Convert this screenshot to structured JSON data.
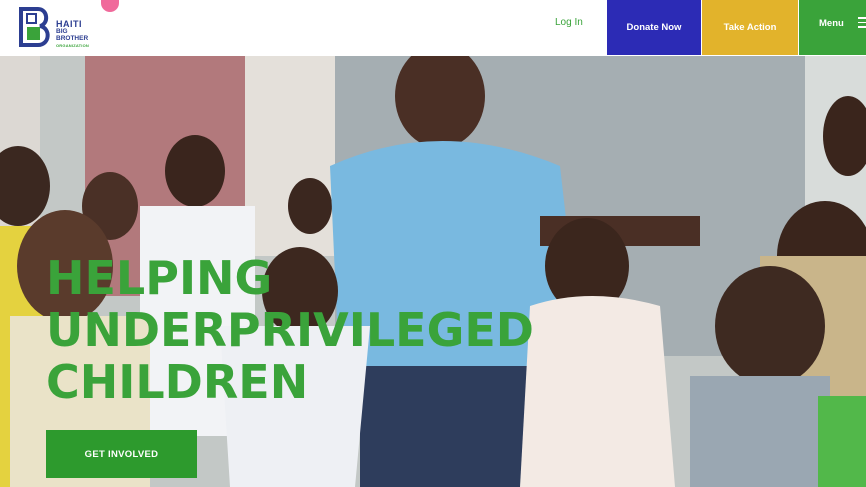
{
  "brand": {
    "line1": "HAITI",
    "line2": "BIG",
    "line3": "BROTHER",
    "line4": "ORGANIZATION",
    "colors": {
      "blue": "#2c3e91",
      "green": "#3aa33a",
      "pink": "#f06a9b"
    }
  },
  "nav": {
    "login": "Log In",
    "donate": "Donate Now",
    "action": "Take Action",
    "menu": "Menu",
    "menu_icon": "hamburger-icon",
    "colors": {
      "donate": "#2c2bb5",
      "action": "#e2b32b",
      "menu": "#3aa33a"
    }
  },
  "hero": {
    "headline": [
      "HELPING",
      "UNDERPRIVILEGED",
      "CHILDREN"
    ],
    "cta": "GET INVOLVED",
    "colors": {
      "headline": "#3aa33a",
      "cta": "#2d9a2d"
    }
  }
}
